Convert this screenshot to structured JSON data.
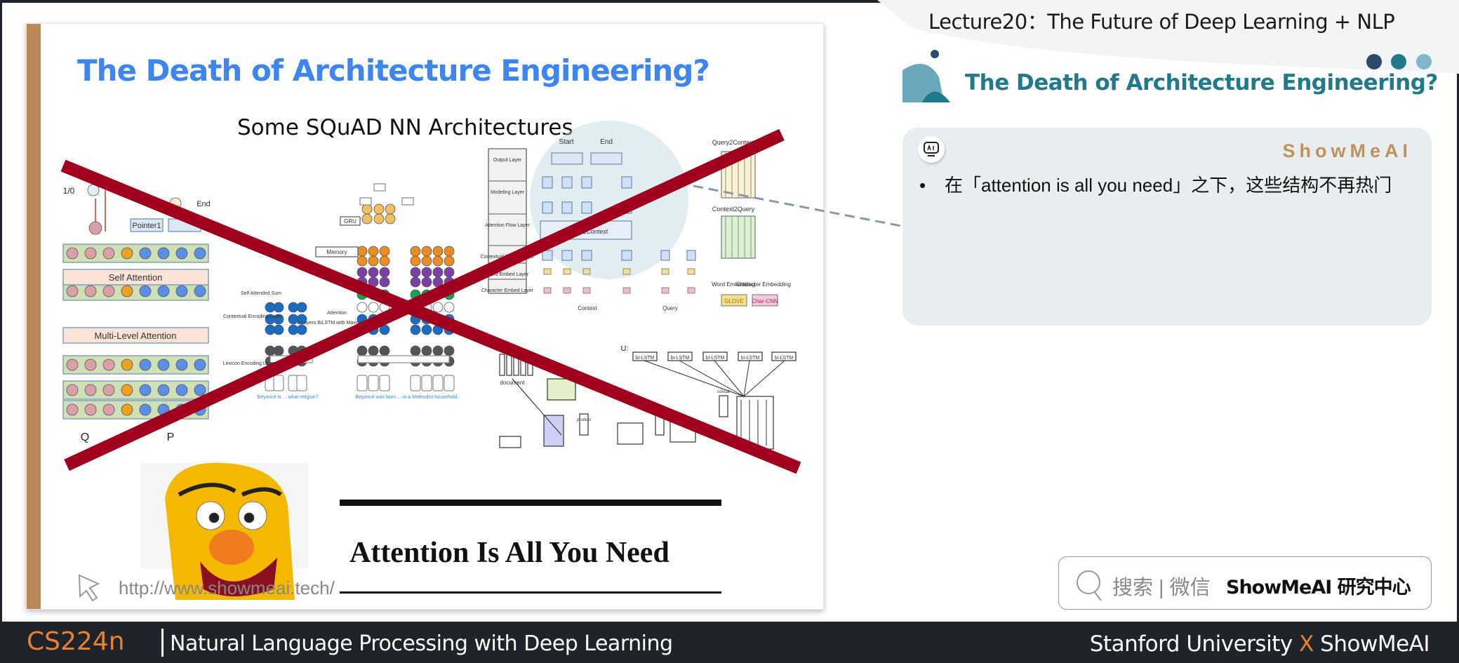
{
  "header": {
    "lecture_title": "Lecture20：The Future of Deep Learning + NLP",
    "section_title": "The Death of Architecture Engineering?"
  },
  "slide": {
    "title": "The Death of Architecture Engineering?",
    "subtitle": "Some SQuAD NN Architectures",
    "paper_title": "Attention Is All You Need",
    "url": "http://www.showmeai.tech/",
    "diagram_labels": {
      "self_attention": "Self Attention",
      "multi_level_attention": "Multi-Level Attention",
      "pointer1": "Pointer1",
      "end": "End",
      "one_zero": "1/0",
      "q": "Q",
      "p": "P",
      "gru": "GRU",
      "memory": "Memory",
      "self_attended_sum": "Self Attended Sum",
      "attention": "Attention",
      "contextual_encoding": "Contextual Encoding Layer",
      "lexicon_encoding": "Lexicon Encoding Layer",
      "bilstm_maxout": "2 Layers BiLSTM with Maxout",
      "q_example": "Beyoncé is ... what religion?",
      "p_example": "Beyoncé was born ... in a Methodist household.",
      "start": "Start",
      "end2": "End",
      "output_layer": "Output Layer",
      "modeling_layer": "Modeling Layer",
      "attention_flow_layer": "Attention Flow Layer",
      "contextual_embed_layer": "Contextual Embed Layer",
      "word_embed_layer": "Word Embed Layer",
      "character_embed_layer": "Character Embed Layer",
      "query2context": "Query2Context",
      "context2query": "Context2Query",
      "word_embedding": "Word Embedding",
      "character_embedding": "Character Embedding",
      "glove": "GLOVE",
      "char_cnn": "Char-CNN",
      "context": "Context",
      "query": "Query",
      "bilstm": "bi-LSTM",
      "document": "document",
      "product": "product",
      "concat": "concat",
      "u": "U:"
    },
    "cross_color": "#a0001e"
  },
  "card": {
    "brand": "ShowMeAI",
    "bullet": "在「attention is all you need」之下，这些结构不再热门"
  },
  "search": {
    "label": "搜索 | 微信",
    "name": "ShowMeAI 研究中心",
    "icon": "search-icon"
  },
  "footer": {
    "course": "CS224n",
    "course_name": "Natural Language Processing with Deep Learning",
    "partner_a": "Stanford University",
    "x": "X",
    "partner_b": "ShowMeAI"
  },
  "colors": {
    "title_blue": "#3d85f0",
    "teal": "#1f7a8c",
    "accent_orange": "#e8822e",
    "footer_bg": "#1f232a",
    "brand_brown": "#c0905f"
  }
}
